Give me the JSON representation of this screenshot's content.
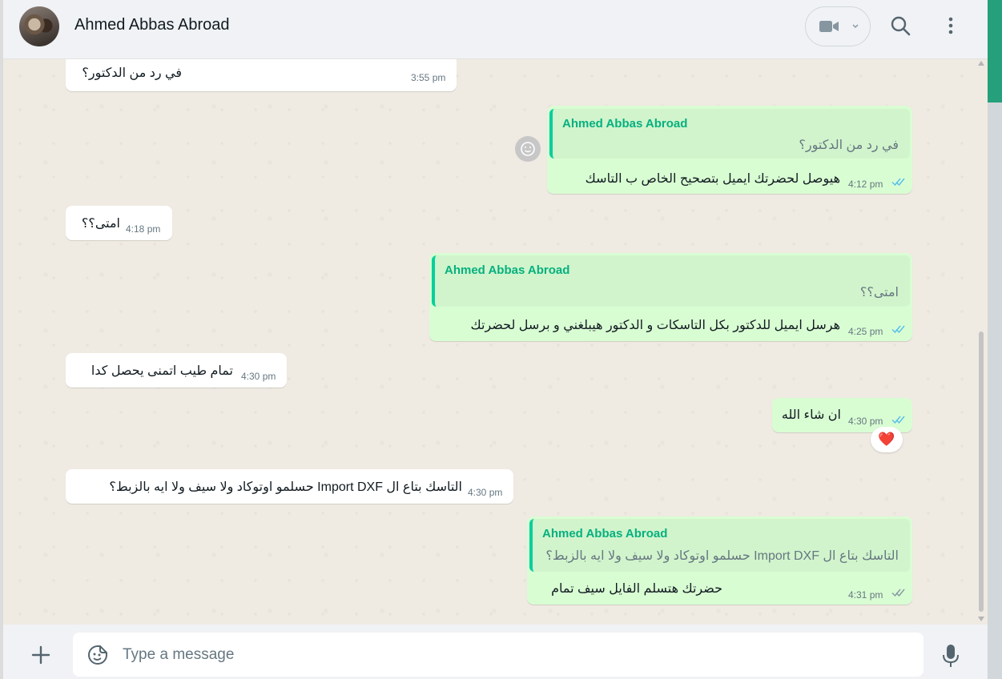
{
  "header": {
    "contact_name": "Ahmed Abbas Abroad"
  },
  "messages": [
    {
      "id": 1,
      "direction": "in",
      "text": "في رد من الدكتور؟",
      "time": "3:55 pm"
    },
    {
      "id": 2,
      "direction": "out",
      "quote_author": "Ahmed Abbas Abroad",
      "quote_text": "في رد من الدكتور؟",
      "text": "هيوصل لحضرتك ايميل بتصحيح الخاص ب التاسك",
      "time": "4:12 pm",
      "status": "read"
    },
    {
      "id": 3,
      "direction": "in",
      "text": "امتى؟؟",
      "time": "4:18 pm"
    },
    {
      "id": 4,
      "direction": "out",
      "quote_author": "Ahmed Abbas Abroad",
      "quote_text": "امتى؟؟",
      "text": "هرسل ايميل للدكتور بكل التاسكات و الدكتور هيبلغني و برسل لحضرتك",
      "time": "4:25 pm",
      "status": "read"
    },
    {
      "id": 5,
      "direction": "in",
      "text": "تمام طيب اتمنى يحصل كدا",
      "time": "4:30 pm"
    },
    {
      "id": 6,
      "direction": "out",
      "text": "ان شاء الله",
      "time": "4:30 pm",
      "status": "read",
      "reaction": "❤️"
    },
    {
      "id": 7,
      "direction": "in",
      "text": "التاسك بتاع ال Import DXF حسلمو اوتوكاد ولا سيف ولا ايه بالزبط؟",
      "time": "4:30 pm"
    },
    {
      "id": 8,
      "direction": "out",
      "quote_author": "Ahmed Abbas Abroad",
      "quote_text": "التاسك بتاع ال Import DXF حسلمو اوتوكاد ولا سيف ولا ايه بالزبط؟",
      "text": "حضرتك هتسلم الفايل سيف تمام",
      "time": "4:31 pm",
      "status": "sent"
    }
  ],
  "composer": {
    "placeholder": "Type a message"
  },
  "icons": {
    "video": "video-camera-icon",
    "search": "search-icon",
    "menu": "kebab-menu-icon",
    "attach": "plus-icon",
    "sticker": "sticker-icon",
    "mic": "microphone-icon",
    "read_ticks": "double-check-icon"
  },
  "colors": {
    "outgoing_bubble": "#d9fdd3",
    "incoming_bubble": "#ffffff",
    "read_tick": "#53bdeb",
    "quote_author": "#06b07f",
    "chat_background": "#efeae2"
  }
}
